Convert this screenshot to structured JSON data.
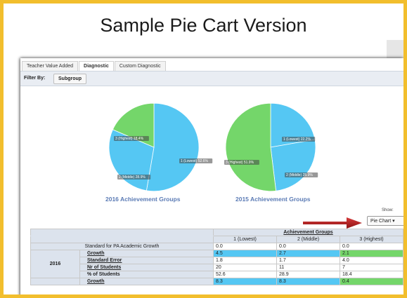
{
  "slide": {
    "title": "Sample Pie Cart Version"
  },
  "tabs": [
    "Teacher Value Added",
    "Diagnostic",
    "Custom Diagnostic"
  ],
  "filter": {
    "label": "Filter By:",
    "button": "Subgroup"
  },
  "colors": {
    "lowest": "#55c7f3",
    "middle": "#55c7f3",
    "highest": "#74d66a",
    "accent_frame": "#f2be2d",
    "arrow": "#b11c1c"
  },
  "chart_data": [
    {
      "type": "pie",
      "title": "2016 Achievement Groups",
      "slices": [
        {
          "label": "1 (Lowest) 52.6%",
          "value": 52.6
        },
        {
          "label": "2 (Middle) 28.9%",
          "value": 28.9
        },
        {
          "label": "3 (Highest) 18.4%",
          "value": 18.4
        }
      ]
    },
    {
      "type": "pie",
      "title": "2015 Achievement Groups",
      "slices": [
        {
          "label": "1 (Lowest) 22.2%",
          "value": 22.2
        },
        {
          "label": "2 (Middle) 25.9%",
          "value": 25.9
        },
        {
          "label": "3 (Highest) 51.9%",
          "value": 51.9
        }
      ]
    }
  ],
  "show": {
    "label": "Show:",
    "value": "Pie Chart ▾"
  },
  "table": {
    "group_header": "Achievement Groups",
    "columns": [
      "1 (Lowest)",
      "2 (Middle)",
      "3 (Highest)"
    ],
    "standard_row": {
      "label": "Standard for PA Academic Growth",
      "values": [
        "0.0",
        "0.0",
        "0.0"
      ]
    },
    "year": "2016",
    "rows": [
      {
        "label": "Growth",
        "values": [
          "4.5",
          "2.7",
          "2.1"
        ]
      },
      {
        "label": "Standard Error",
        "values": [
          "1.8",
          "1.7",
          "4.0"
        ]
      },
      {
        "label": "Nr of Students",
        "values": [
          "20",
          "11",
          "7"
        ]
      },
      {
        "label": "% of Students",
        "values": [
          "52.6",
          "28.9",
          "18.4"
        ]
      }
    ],
    "next_row": {
      "label": "Growth",
      "values": [
        "8.3",
        "8.3",
        "0.4"
      ]
    }
  }
}
